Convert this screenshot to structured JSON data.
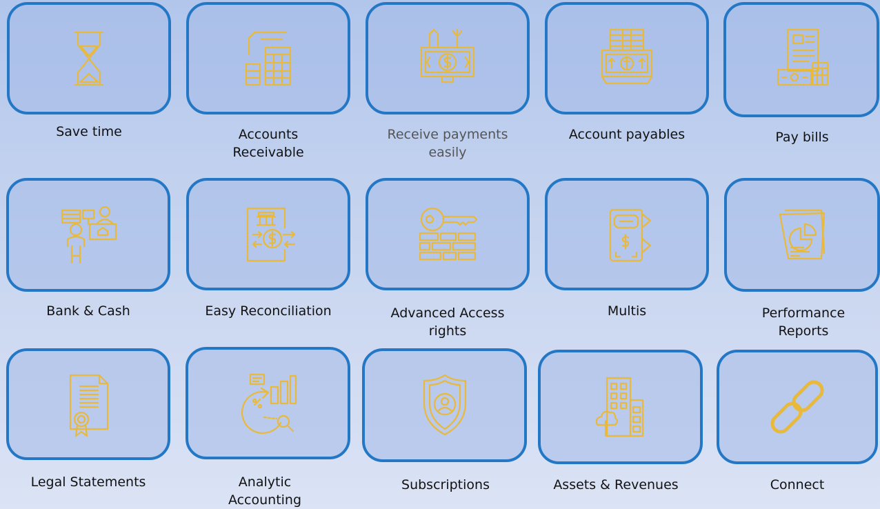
{
  "colors": {
    "tile_border": "#2377c4",
    "icon": "#e8b93a",
    "label": "#111111",
    "label_muted": "#555555"
  },
  "features": [
    {
      "label": "Save time",
      "icon": "hourglass-icon"
    },
    {
      "label": "Accounts\nReceivable",
      "icon": "receivable-icon"
    },
    {
      "label": "Receive payments\neasily",
      "icon": "payment-tools-icon"
    },
    {
      "label": "Account payables",
      "icon": "payables-icon"
    },
    {
      "label": "Pay bills",
      "icon": "bill-calculator-icon"
    },
    {
      "label": "Bank & Cash",
      "icon": "bank-cashier-icon"
    },
    {
      "label": "Easy Reconciliation",
      "icon": "reconciliation-icon"
    },
    {
      "label": "Advanced Access\nrights",
      "icon": "key-access-icon"
    },
    {
      "label": "Multis",
      "icon": "multi-wallet-icon"
    },
    {
      "label": "Performance\nReports",
      "icon": "report-chart-icon"
    },
    {
      "label": "Legal Statements",
      "icon": "certificate-icon"
    },
    {
      "label": "Analytic\nAccounting",
      "icon": "analytics-icon"
    },
    {
      "label": "Subscriptions",
      "icon": "user-shield-icon"
    },
    {
      "label": "Assets & Revenues",
      "icon": "building-icon"
    },
    {
      "label": "Connect",
      "icon": "link-icon"
    }
  ]
}
